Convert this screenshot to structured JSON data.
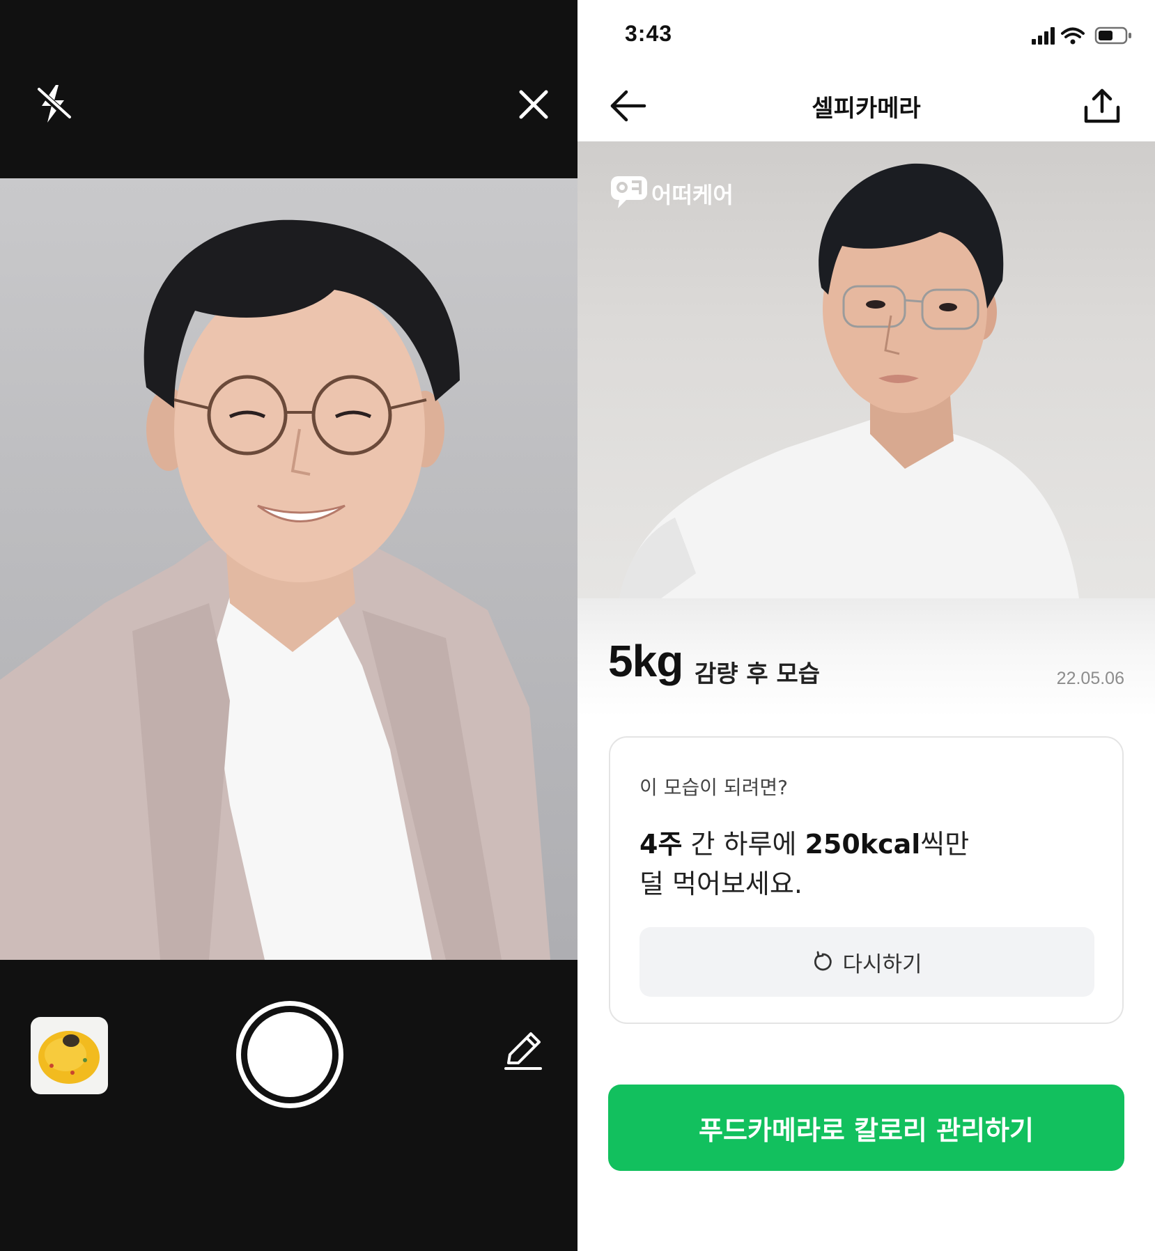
{
  "camera_screen": {
    "flash_icon": "flash-off-icon",
    "close_icon": "close-icon",
    "last_photo_icon": "food-thumbnail",
    "edit_icon": "pencil-icon"
  },
  "result_screen": {
    "status_bar": {
      "time": "3:43"
    },
    "nav": {
      "title": "셀피카메라",
      "back_icon": "arrow-left-icon",
      "share_icon": "share-icon"
    },
    "brand_logo_text": "어떠케어",
    "result": {
      "weight": "5kg",
      "caption": "감량 후 모습",
      "date": "22.05.06"
    },
    "tip_card": {
      "question": "이 모습이 되려면?",
      "weeks": "4주",
      "text_a": " 간 하루에 ",
      "kcal": "250kcal",
      "text_b": "씩만",
      "line2": "덜 먹어보세요.",
      "retry_label": "다시하기"
    },
    "cta_label": "푸드카메라로 칼로리 관리하기",
    "colors": {
      "cta_green": "#12c05e",
      "camera_background": "#111111"
    }
  }
}
